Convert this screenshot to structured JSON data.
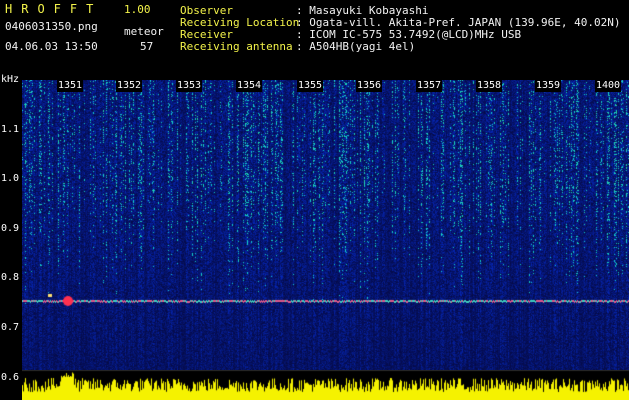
{
  "app": {
    "title": "HROFFT",
    "version": "1.00"
  },
  "header_left": {
    "filename": "0406031350.png",
    "datetime": "04.06.03 13:50",
    "meteor_label": "meteor",
    "meteor_count": "57"
  },
  "info": {
    "observer_label": "Observer",
    "observer_value": ": Masayuki Kobayashi",
    "location_label": "Receiving Location",
    "location_value": ": Ogata-vill. Akita-Pref. JAPAN (139.96E, 40.02N)",
    "receiver_label": "Receiver",
    "receiver_value": ": ICOM IC-575 53.7492(@LCD)MHz USB",
    "antenna_label": "Receiving antenna",
    "antenna_value": ": A504HB(yagi 4el)"
  },
  "axis": {
    "unit": "kHz",
    "y_ticks": [
      "1.1",
      "1.0",
      "0.9",
      "0.8",
      "0.7",
      "0.6"
    ],
    "time_ticks": [
      "1351",
      "1352",
      "1353",
      "1354",
      "1355",
      "1356",
      "1357",
      "1358",
      "1359",
      "1400"
    ]
  },
  "colors": {
    "background": "#000000",
    "text_yellow": "#f3f34a",
    "spectrogram_base": "#0a1a6e",
    "signal_line": "#e05a8a",
    "meter_bars": "#f5f200"
  }
}
